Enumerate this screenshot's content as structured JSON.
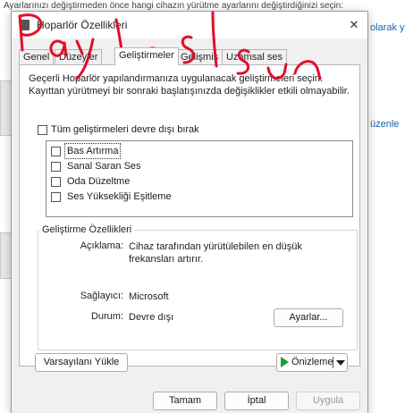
{
  "background": {
    "top_text": "Ayarlarınızı değiştirmeden önce hangi cihazın yürütme ayarlarını değiştirdiğinizi seçin:",
    "right_link_1": "olarak yü",
    "right_link_2": "üzenle"
  },
  "dialog": {
    "title": "Hoparlör Özellikleri",
    "close_glyph": "✕",
    "tabs": [
      {
        "label": "Genel"
      },
      {
        "label": "Düzeyler"
      },
      {
        "label": "Geliştirmeler"
      },
      {
        "label": "Gelişmiş"
      },
      {
        "label": "Uzamsal ses"
      }
    ],
    "description": "Geçerli Hoparlör yapılandırmanıza uygulanacak geliştirmeleri seçin. Kayıttan yürütmeyi bir sonraki başlatışınızda değişiklikler etkili olmayabilir.",
    "disable_all_label": "Tüm geliştirmeleri devre dışı bırak",
    "enhancements": [
      {
        "label": "Bas Artırma",
        "checked": false
      },
      {
        "label": "Sanal Saran Ses",
        "checked": false
      },
      {
        "label": "Oda Düzeltme",
        "checked": false
      },
      {
        "label": "Ses Yüksekliği Eşitleme",
        "checked": false
      }
    ],
    "properties": {
      "group_title": "Geliştirme Özellikleri",
      "description_label": "Açıklama:",
      "description_value": "Cihaz tarafından yürütülebilen en düşük frekansları artırır.",
      "provider_label": "Sağlayıcı:",
      "provider_value": "Microsoft",
      "status_label": "Durum:",
      "status_value": "Devre dışı",
      "settings_button": "Ayarlar..."
    },
    "restore_defaults_button": "Varsayılanı Yükle",
    "preview_button": "Önizleme",
    "ok_button": "Tamam",
    "cancel_button": "İptal",
    "apply_button": "Uygula"
  },
  "scribble": {
    "text": "Paylaşılsın",
    "color": "#e0102a"
  },
  "colors": {
    "dialog_bg": "#f0f0f0",
    "preview_green": "#1a9c3a",
    "link_blue": "#1a5fb4"
  }
}
